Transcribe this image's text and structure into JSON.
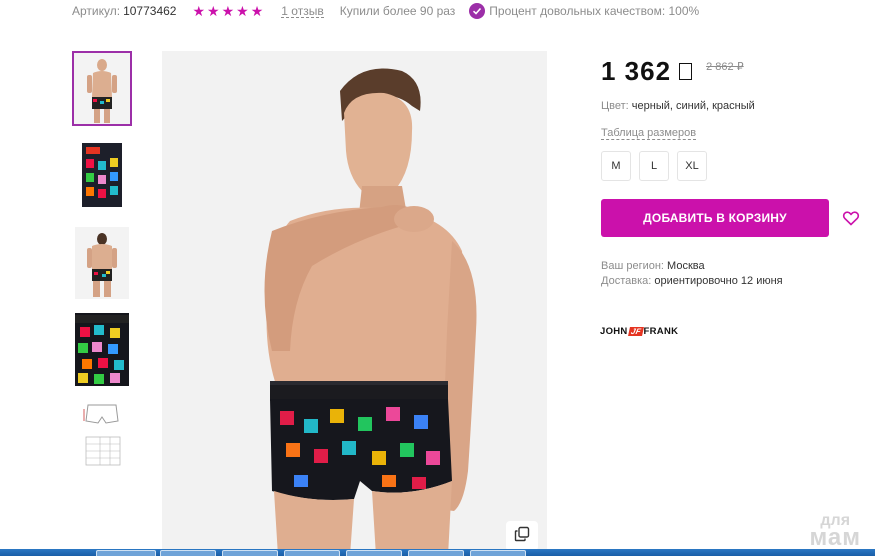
{
  "meta": {
    "article_label": "Артикул:",
    "article_value": "10773462",
    "rating_stars": 5,
    "reviews": "1 отзыв",
    "bought": "Купили более 90 раз",
    "quality": "Процент довольных качеством: 100%"
  },
  "thumbnails": [
    {
      "name": "thumb-model-front",
      "active": true
    },
    {
      "name": "thumb-package"
    },
    {
      "name": "thumb-model-back"
    },
    {
      "name": "thumb-fabric-print"
    },
    {
      "name": "thumb-size-chart"
    }
  ],
  "price": {
    "current": "1 362",
    "currency_icon": "ruble-glyph-box",
    "old": "2 862 ₽"
  },
  "color": {
    "label": "Цвет:",
    "value": "черный, синий, красный"
  },
  "size_table_link": "Таблица размеров",
  "sizes": [
    "M",
    "L",
    "XL"
  ],
  "add_to_cart": "ДОБАВИТЬ В КОРЗИНУ",
  "region": {
    "label": "Ваш регион:",
    "value": "Москва",
    "delivery_label": "Доставка:",
    "delivery_value": "ориентировочно 12 июня"
  },
  "brand": {
    "left": "JOHN",
    "mark": "JF",
    "right": "FRANK"
  },
  "watermark": {
    "line1": "для",
    "line2": "мам"
  },
  "colors": {
    "accent": "#cb11ab",
    "check": "#9c2fa8",
    "brand_red": "#e53421"
  }
}
